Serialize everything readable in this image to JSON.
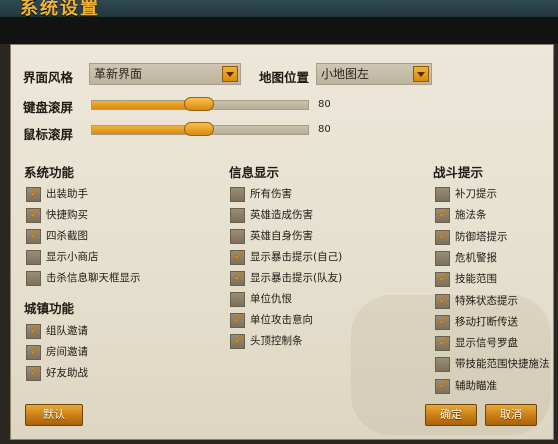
{
  "header": {
    "title": "系统设置"
  },
  "interface": {
    "label": "界面风格",
    "value": "革新界面"
  },
  "map_position": {
    "label": "地图位置",
    "value": "小地图左"
  },
  "keyboard_scroll": {
    "label": "键盘滚屏",
    "value": "80",
    "level_percent": 80
  },
  "mouse_scroll": {
    "label": "鼠标滚屏",
    "value": "80",
    "level_percent": 80
  },
  "system": {
    "title": "系统功能",
    "items": [
      {
        "label": "出装助手",
        "checked": true
      },
      {
        "label": "快捷购买",
        "checked": true
      },
      {
        "label": "四杀截图",
        "checked": true
      },
      {
        "label": "显示小商店",
        "checked": false
      },
      {
        "label": "击杀信息聊天框显示",
        "checked": false
      }
    ]
  },
  "town": {
    "title": "城镇功能",
    "items": [
      {
        "label": "组队邀请",
        "checked": true
      },
      {
        "label": "房间邀请",
        "checked": true
      },
      {
        "label": "好友助战",
        "checked": true
      }
    ]
  },
  "info": {
    "title": "信息显示",
    "items": [
      {
        "label": "所有伤害",
        "checked": false
      },
      {
        "label": "英雄造成伤害",
        "checked": false
      },
      {
        "label": "英雄自身伤害",
        "checked": false
      },
      {
        "label": "显示暴击提示(自己)",
        "checked": true
      },
      {
        "label": "显示暴击提示(队友)",
        "checked": true
      },
      {
        "label": "单位仇恨",
        "checked": false
      },
      {
        "label": "单位攻击意向",
        "checked": true
      },
      {
        "label": "头顶控制条",
        "checked": true
      }
    ]
  },
  "battle": {
    "title": "战斗提示",
    "items": [
      {
        "label": "补刀提示",
        "checked": false
      },
      {
        "label": "施法条",
        "checked": true
      },
      {
        "label": "防御塔提示",
        "checked": true
      },
      {
        "label": "危机警报",
        "checked": false
      },
      {
        "label": "技能范围",
        "checked": true
      },
      {
        "label": "特殊状态提示",
        "checked": true
      },
      {
        "label": "移动打断传送",
        "checked": true
      },
      {
        "label": "显示信号罗盘",
        "checked": true
      },
      {
        "label": "带技能范围快捷施法",
        "checked": false
      },
      {
        "label": "辅助瞄准",
        "checked": true
      }
    ]
  },
  "footer": {
    "default_label": "默认",
    "ok_label": "确定",
    "cancel_label": "取消"
  },
  "colors": {
    "accent": "#e88f0a",
    "panel_bg": "#e9e3d4",
    "button": "#d98a12"
  }
}
